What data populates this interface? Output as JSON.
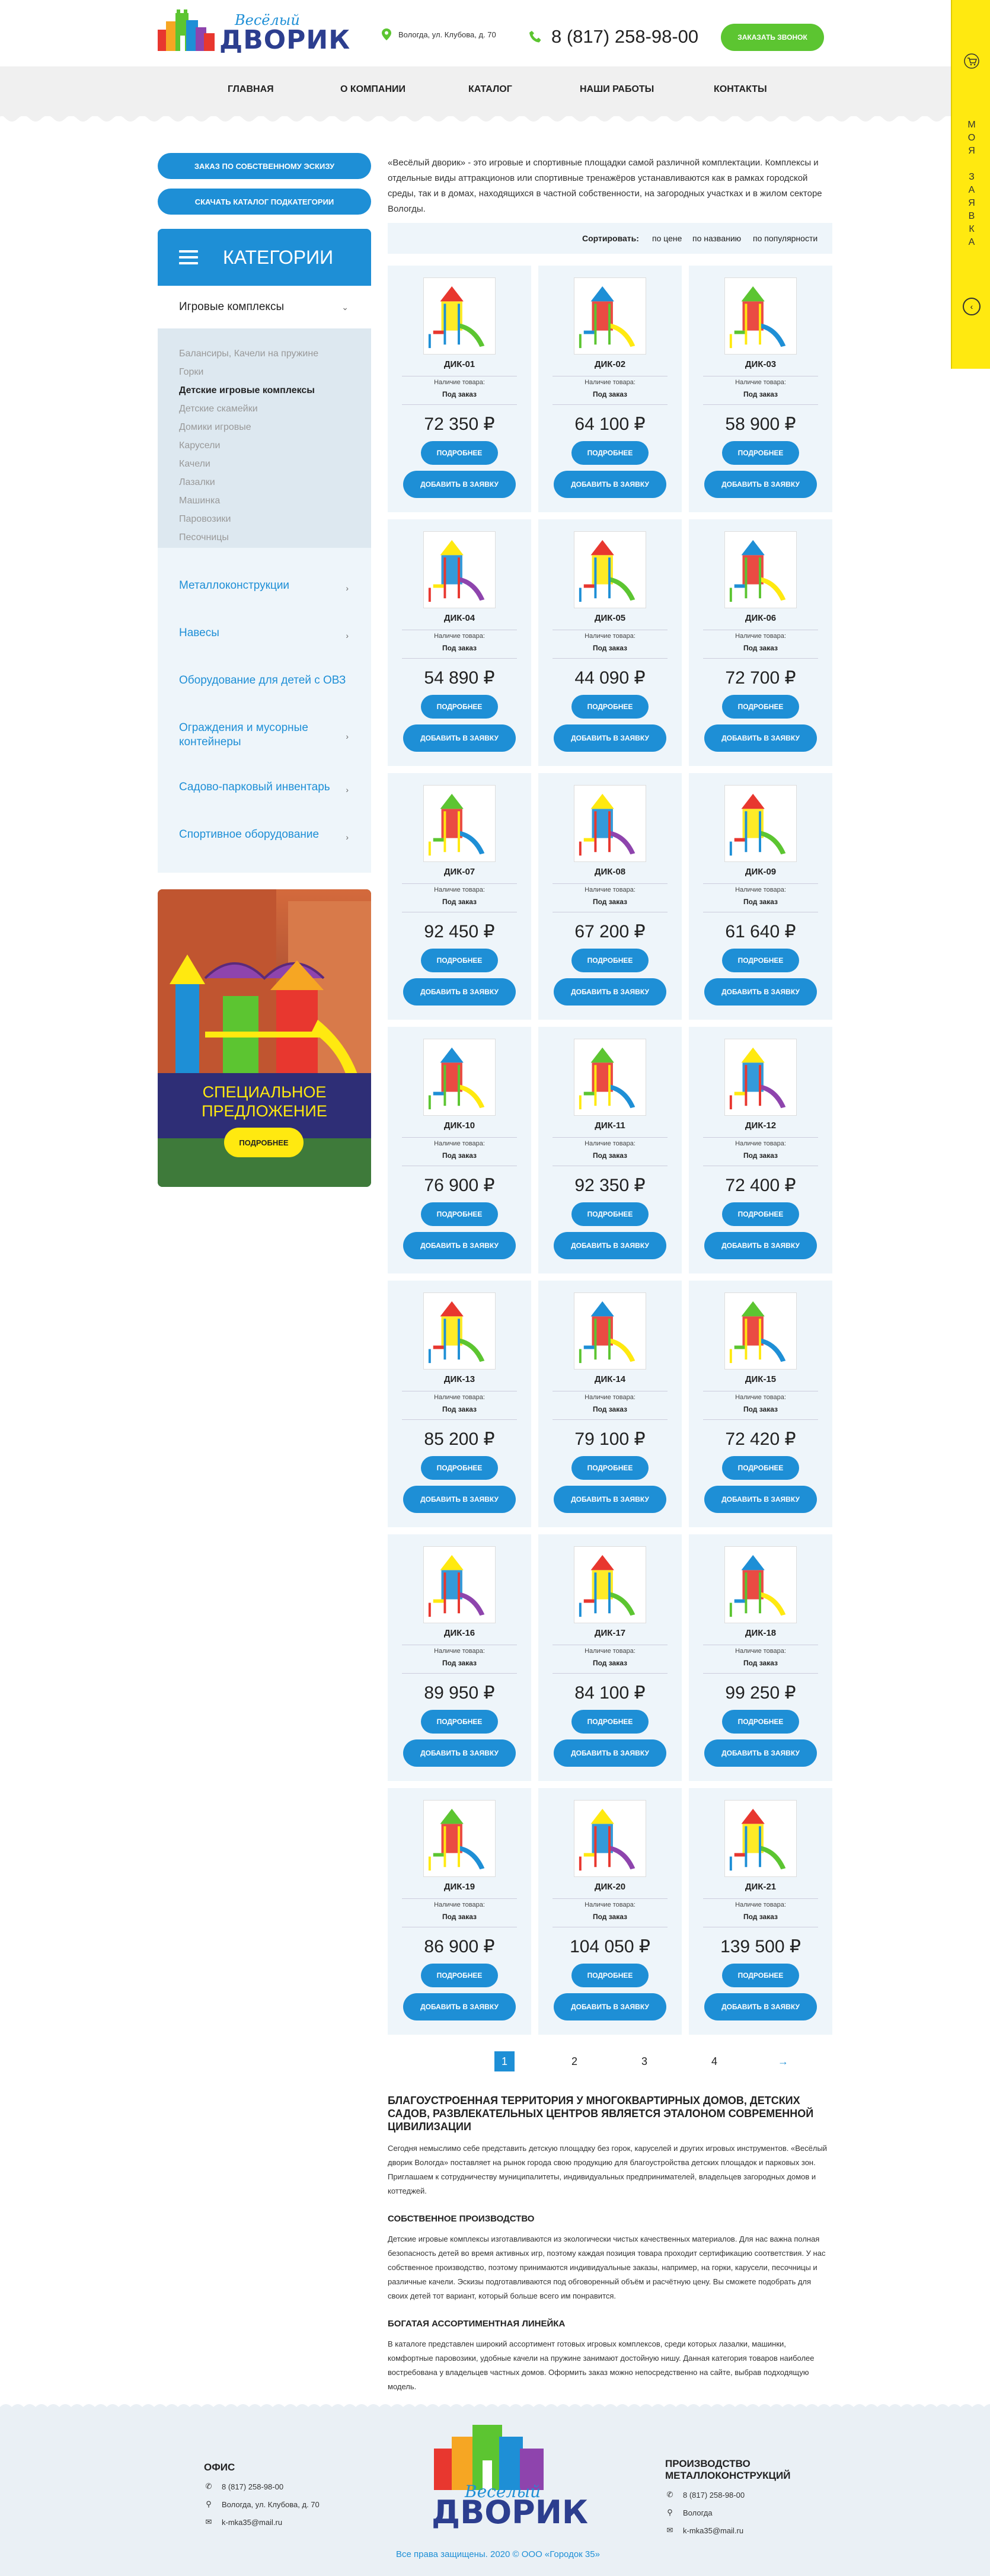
{
  "header": {
    "logo_small": "Весёлый",
    "logo_big": "ДВОРИК",
    "address": "Вологда, ул. Клубова, д. 70",
    "phone": "8 (817) 258-98-00",
    "callback_label": "заказать звонок"
  },
  "nav": [
    "Главная",
    "О компании",
    "Каталог",
    "Наши работы",
    "Контакты"
  ],
  "side_tab": {
    "label": "МОЯ ЗАЯВКА"
  },
  "sidebar": {
    "btn_sketch": "Заказ по собственному эскизу",
    "btn_catalog": "Скачать каталог подкатегории",
    "categories_title": "Категории",
    "open_category": "Игровые комплексы",
    "subcategories": [
      "Балансиры, Качели на пружине",
      "Горки",
      "Детские игровые комплексы",
      "Детские скамейки",
      "Домики игровые",
      "Карусели",
      "Качели",
      "Лазалки",
      "Машинка",
      "Паровозики",
      "Песочницы"
    ],
    "active_subcategory": "Детские игровые комплексы",
    "categories": [
      "Металлоконструкции",
      "Навесы",
      "Оборудование для детей с ОВЗ",
      "Ограждения и мусорные контейнеры",
      "Садово-парковый инвентарь",
      "Спортивное оборудование"
    ],
    "promo_text_1": "Специальное",
    "promo_text_2": "предложение",
    "promo_button": "Подробнее"
  },
  "intro": "«Весёлый дворик» - это игровые и спортивные площадки самой различной комплектации. Комплексы и отдельные виды аттракционов или спортивные тренажёров устанавливаются как в рамках городской среды, так и в домах, находящихся в частной собственности, на загородных участках и в жилом секторе Вологды.",
  "sort": {
    "label": "Сортировать:",
    "by_price": "по цене",
    "by_name": "по названию",
    "by_popularity": "по популярности"
  },
  "card_labels": {
    "availability_label": "Наличие товара:",
    "availability_value": "Под заказ",
    "more": "Подробнее",
    "add": "Добавить в заявку"
  },
  "products": [
    {
      "name": "ДИК-01",
      "price": "72 350 ₽"
    },
    {
      "name": "ДИК-02",
      "price": "64 100 ₽"
    },
    {
      "name": "ДИК-03",
      "price": "58 900 ₽"
    },
    {
      "name": "ДИК-04",
      "price": "54 890 ₽"
    },
    {
      "name": "ДИК-05",
      "price": "44 090 ₽"
    },
    {
      "name": "ДИК-06",
      "price": "72 700 ₽"
    },
    {
      "name": "ДИК-07",
      "price": "92 450 ₽"
    },
    {
      "name": "ДИК-08",
      "price": "67 200 ₽"
    },
    {
      "name": "ДИК-09",
      "price": "61 640 ₽"
    },
    {
      "name": "ДИК-10",
      "price": "76 900 ₽"
    },
    {
      "name": "ДИК-11",
      "price": "92 350 ₽"
    },
    {
      "name": "ДИК-12",
      "price": "72 400 ₽"
    },
    {
      "name": "ДИК-13",
      "price": "85 200 ₽"
    },
    {
      "name": "ДИК-14",
      "price": "79 100 ₽"
    },
    {
      "name": "ДИК-15",
      "price": "72 420 ₽"
    },
    {
      "name": "ДИК-16",
      "price": "89 950 ₽"
    },
    {
      "name": "ДИК-17",
      "price": "84 100 ₽"
    },
    {
      "name": "ДИК-18",
      "price": "99 250 ₽"
    },
    {
      "name": "ДИК-19",
      "price": "86 900 ₽"
    },
    {
      "name": "ДИК-20",
      "price": "104 050 ₽"
    },
    {
      "name": "ДИК-21",
      "price": "139 500 ₽"
    }
  ],
  "pagination": {
    "pages": [
      "1",
      "2",
      "3",
      "4"
    ],
    "current": "1",
    "next": "→"
  },
  "seo": {
    "h1": "Благоустроенная территория у многоквартирных домов, детских садов, развлекательных центров является эталоном современной цивилизации",
    "p1": "Сегодня немыслимо себе представить детскую площадку без горок, каруселей и других игровых инструментов. «Весёлый дворик Вологда» поставляет на рынок города свою продукцию для благоустройства детских площадок и парковых зон. Приглашаем к сотрудничеству муниципалитеты, индивидуальных предпринимателей, владельцев загородных домов и коттеджей.",
    "h2": "Собственное производство",
    "p2": "Детские игровые комплексы изготавливаются из экологически чистых качественных материалов. Для нас важна полная безопасность детей во время активных игр, поэтому каждая позиция товара проходит сертификацию соответствия. У нас собственное производство, поэтому принимаются индивидуальные заказы, например, на горки, карусели, песочницы и различные качели. Эскизы подготавливаются под обговоренный объём и расчётную цену. Вы сможете подобрать для своих детей тот вариант, который больше всего им понравится.",
    "h3": "Богатая ассортиментная линейка",
    "p3": "В каталоге представлен широкий ассортимент готовых игровых комплексов, среди которых лазалки, машинки, комфортные паровозики, удобные качели на пружине занимают достойную нишу. Данная категория товаров наиболее востребована у владельцев частных домов. Оформить заказ можно непосредственно на сайте, выбрав подходящую модель."
  },
  "footer": {
    "office_title": "Офис",
    "office_phone": "8 (817) 258-98-00",
    "office_address": "Вологда, ул. Клубова, д. 70",
    "office_email": "k-mka35@mail.ru",
    "prod_title_1": "Производство",
    "prod_title_2": "металлоконструкций",
    "prod_phone": "8 (817) 258-98-00",
    "prod_city": "Вологда",
    "prod_email": "k-mka35@mail.ru",
    "logo_small": "Весёлый",
    "logo_big": "ДВОРИК",
    "copyright": "Все права защищены. 2020 © ООО «Городок 35»"
  },
  "colors": {
    "accent_blue": "#1e8fd6",
    "green": "#5cc531",
    "yellow": "#ffe910",
    "brand_navy": "#2c3e8f"
  }
}
